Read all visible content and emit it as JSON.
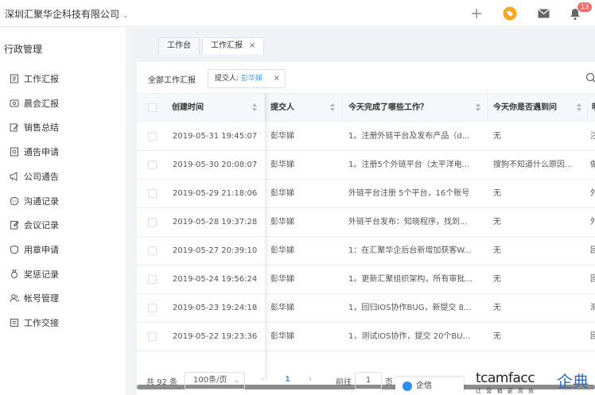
{
  "header": {
    "company": "深圳汇聚华企科技有限公司",
    "badge_count": "13",
    "icons": [
      "plus-icon",
      "tag-icon",
      "mail-icon",
      "bell-icon"
    ]
  },
  "sidebar": {
    "title": "行政管理",
    "items": [
      {
        "label": "工作汇报",
        "icon": "report-icon"
      },
      {
        "label": "晨会汇报",
        "icon": "meeting-icon"
      },
      {
        "label": "销售总结",
        "icon": "edit-icon"
      },
      {
        "label": "通告申请",
        "icon": "notice-apply-icon"
      },
      {
        "label": "公司通告",
        "icon": "megaphone-icon"
      },
      {
        "label": "沟通记录",
        "icon": "chat-icon"
      },
      {
        "label": "会议记录",
        "icon": "note-icon"
      },
      {
        "label": "用章申请",
        "icon": "seal-icon"
      },
      {
        "label": "奖惩记录",
        "icon": "award-icon"
      },
      {
        "label": "帐号管理",
        "icon": "users-icon"
      },
      {
        "label": "工作交接",
        "icon": "handover-icon"
      }
    ]
  },
  "tabs": [
    {
      "label": "工作台",
      "active": false
    },
    {
      "label": "工作汇报",
      "active": true,
      "close": "×"
    }
  ],
  "filter": {
    "label": "全部工作汇报",
    "tag_key": "提交人: ",
    "tag_value": "彭华娣",
    "tag_close": "×"
  },
  "table": {
    "columns": [
      "创建时间",
      "提交人",
      "今天完成了哪些工作？",
      "今天你是否遇到问",
      "明"
    ],
    "rows": [
      {
        "time": "2019-05-31 19:45:07",
        "submitter": "彭华娣",
        "done": "1。注册外链平台及发布产品（d...",
        "issue": "无",
        "extra": "注"
      },
      {
        "time": "2019-05-30 20:08:07",
        "submitter": "彭华娣",
        "done": "1。注册5个外链平台（太平洋电...",
        "issue": "搜狗不知道什么原因...",
        "extra": "做"
      },
      {
        "time": "2019-05-29 21:18:06",
        "submitter": "彭华娣",
        "done": "外链平台注册 5个平台，16个账号",
        "issue": "无",
        "extra": "外"
      },
      {
        "time": "2019-05-28 19:37:28",
        "submitter": "彭华娣",
        "done": "外链平台发布：知晓程序，找到...",
        "issue": "无",
        "extra": "外"
      },
      {
        "time": "2019-05-27 20:39:10",
        "submitter": "彭华娣",
        "done": "1：在汇聚华企后台新增加获客W...",
        "issue": "无",
        "extra": "回"
      },
      {
        "time": "2019-05-24 19:56:24",
        "submitter": "彭华娣",
        "done": "1。更新汇聚组织架构，所有审批...",
        "issue": "无",
        "extra": "回"
      },
      {
        "time": "2019-05-23 19:24:18",
        "submitter": "彭华娣",
        "done": "1，回归IOS协作BUG，新提交 8...",
        "issue": "无",
        "extra": "测"
      },
      {
        "time": "2019-05-22 19:23:36",
        "submitter": "彭华娣",
        "done": "1，测试IOS协作，提交 20个BU...",
        "issue": "无",
        "extra": "回"
      }
    ]
  },
  "pagination": {
    "total": "共 92 条",
    "page_size": "100条/页",
    "prev": "‹",
    "current": "1",
    "next": "›",
    "goto": "前往",
    "goto_value": "1",
    "page_suffix": "页"
  },
  "chat_widget": {
    "label": "企信"
  },
  "watermark": {
    "en": "tcamfacc",
    "cn": "企典",
    "sub": "让 营 销 更 高 效"
  },
  "colors": {
    "accent": "#409eff",
    "badge": "#f56c6c",
    "tag_icon": "#f5a623"
  }
}
